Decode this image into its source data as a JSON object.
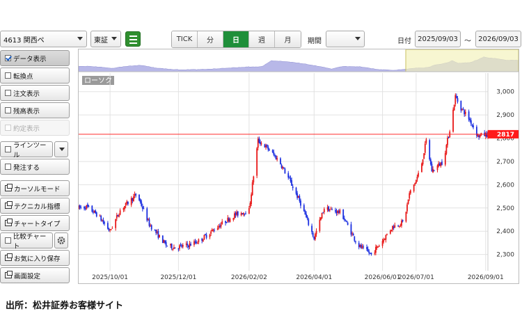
{
  "toolbar": {
    "stock": "4613 関西ペ",
    "market": "東証",
    "tabs": [
      "TICK",
      "分",
      "日",
      "週",
      "月"
    ],
    "active_tab": "日",
    "period_label": "期間",
    "period_value": "",
    "date_label": "日付",
    "date_from": "2025/09/03",
    "date_sep": "〜",
    "date_to": "2026/09/03"
  },
  "sidebar": {
    "items": [
      {
        "label": "データ表示",
        "kind": "check",
        "checked": true
      },
      {
        "label": "転換点",
        "kind": "check",
        "checked": false
      },
      {
        "label": "注文表示",
        "kind": "check",
        "checked": false
      },
      {
        "label": "残高表示",
        "kind": "check",
        "checked": false
      },
      {
        "label": "約定表示",
        "kind": "check",
        "checked": false,
        "disabled": true
      },
      {
        "label": "ラインツール",
        "kind": "check",
        "checked": false
      },
      {
        "label": "発注する",
        "kind": "check",
        "checked": false
      },
      {
        "label": "カーソルモード",
        "kind": "win"
      },
      {
        "label": "テクニカル指標",
        "kind": "win"
      },
      {
        "label": "チャートタイプ",
        "kind": "win"
      },
      {
        "label": "比較チャート",
        "kind": "check",
        "checked": false
      },
      {
        "label": "お気に入り保存",
        "kind": "win"
      },
      {
        "label": "画面設定",
        "kind": "win"
      }
    ]
  },
  "chart_label": "ローソク",
  "current_price_label": "2817",
  "caption": "出所：松井証券お客様サイト",
  "colors": {
    "up": "#e81818",
    "down": "#1a2ee0",
    "price_line": "#ff2a2a",
    "active_tab": "#1f8f3a"
  },
  "chart_data": {
    "type": "candlestick",
    "y_ticks": [
      "3,000",
      "2,900",
      "2,800",
      "2,700",
      "2,600",
      "2,500",
      "2,400",
      "2,300"
    ],
    "ylim": [
      2230,
      3080
    ],
    "x_ticks": [
      "2025/10/01",
      "2025/12/01",
      "2026/02/02",
      "2026/04/01",
      "2026/06/01",
      "2026/07/01",
      "2026/09/01"
    ],
    "current_price": 2817,
    "trend_days": [
      "2025-09-03",
      "2025-09-10",
      "2025-09-20",
      "2025-10-01",
      "2025-10-10",
      "2025-10-25",
      "2025-11-05",
      "2025-11-20",
      "2025-11-28",
      "2025-12-10",
      "2025-12-20",
      "2026-01-05",
      "2026-01-20",
      "2026-02-02",
      "2026-02-10",
      "2026-02-20",
      "2026-03-01",
      "2026-03-10",
      "2026-03-20",
      "2026-04-01",
      "2026-04-10",
      "2026-04-25",
      "2026-05-10",
      "2026-05-22",
      "2026-06-01",
      "2026-06-10",
      "2026-06-20",
      "2026-06-25",
      "2026-07-01",
      "2026-07-05",
      "2026-07-10",
      "2026-07-15",
      "2026-07-25",
      "2026-08-01",
      "2026-08-05",
      "2026-08-10",
      "2026-08-15",
      "2026-08-20",
      "2026-08-25",
      "2026-09-03"
    ],
    "trend_prices": [
      2500,
      2505,
      2470,
      2400,
      2490,
      2560,
      2430,
      2340,
      2330,
      2340,
      2360,
      2420,
      2470,
      2490,
      2790,
      2750,
      2700,
      2620,
      2520,
      2370,
      2500,
      2480,
      2340,
      2300,
      2360,
      2420,
      2440,
      2560,
      2620,
      2670,
      2790,
      2660,
      2700,
      2860,
      2980,
      2930,
      2900,
      2860,
      2810,
      2817
    ],
    "annotation": "chart drawn from approximate daily trend read from screenshot"
  }
}
